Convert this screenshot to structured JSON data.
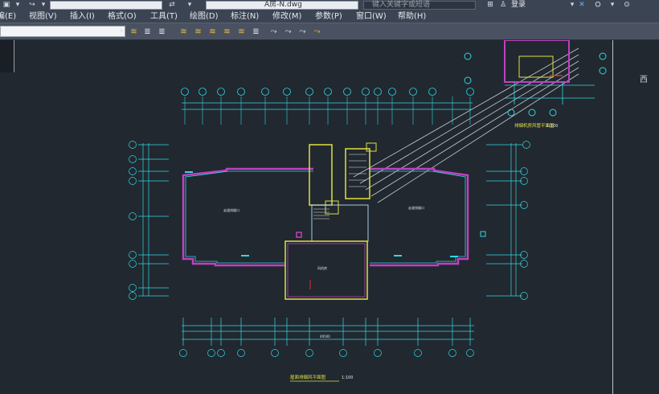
{
  "titlebar": {
    "file_title": "A房-N.dwg",
    "search_placeholder": "键入关键字或短语",
    "login_label": "登录"
  },
  "menu": {
    "items": [
      "编(E)",
      "视图(V)",
      "插入(I)",
      "格式(O)",
      "工具(T)",
      "绘图(D)",
      "标注(N)",
      "修改(M)",
      "参数(P)",
      "窗口(W)",
      "帮助(H)"
    ]
  },
  "drawing": {
    "top_grid_labels": [
      "①",
      "②",
      "③",
      "⑤",
      "⑦",
      "⑧",
      "⑨",
      "⑩",
      "⑪",
      "⑫",
      "⑬",
      "⑭",
      "⑮",
      "⑯",
      "⑰"
    ],
    "bottom_grid_labels": [
      "①",
      "⑬",
      "⑮",
      "⑦",
      "⑨",
      "⑪",
      "⑬",
      "⑮",
      "⑰"
    ],
    "left_grid_labels": [
      "Ⓐ",
      "Ⓑ",
      "Ⓒ",
      "Ⓓ",
      "Ⓔ",
      "Ⓕ",
      "Ⓖ",
      "Ⓗ",
      "Ⓘ"
    ],
    "right_grid_labels": [
      "Ⓐ",
      "Ⓑ",
      "Ⓒ",
      "Ⓓ",
      "Ⓔ",
      "Ⓕ",
      "Ⓖ"
    ],
    "room_label_left": "走道排烟口",
    "room_label_right": "走道排烟口",
    "room_label_center": "风机房",
    "plan_title": "屋面排烟风平面图",
    "plan_scale": "1:100",
    "detail_title": "排烟机房风管平面图",
    "detail_scale": "1:100",
    "dim_total": "49500",
    "viewcube_label": "西"
  },
  "colors": {
    "canvas_bg": "#212830",
    "wall_magenta": "#c040c0",
    "grid_cyan": "#30d8e0",
    "stair_yellow": "#e0e040",
    "leader_white": "#d0d4d8",
    "accent_red": "#e03030"
  }
}
